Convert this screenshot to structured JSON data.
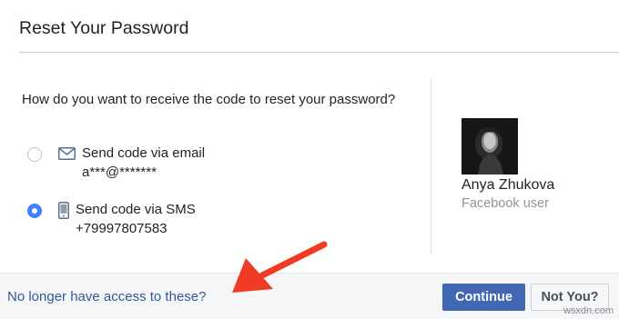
{
  "dialog": {
    "title": "Reset Your Password"
  },
  "main": {
    "question": "How do you want to receive the code to reset your password?",
    "options": [
      {
        "icon": "envelope-icon",
        "label": "Send code via email",
        "value": "a***@*******",
        "selected": false
      },
      {
        "icon": "mobile-phone-icon",
        "label": "Send code via SMS",
        "value": "+79997807583",
        "selected": true
      }
    ]
  },
  "profile": {
    "name": "Anya Zhukova",
    "subtitle": "Facebook user"
  },
  "footer": {
    "link_label": "No longer have access to these?",
    "continue_label": "Continue",
    "not_you_label": "Not You?"
  },
  "annotation": {
    "arrow_color": "#f03c26"
  },
  "watermark": "wsxdn.com",
  "colors": {
    "primary": "#4267b2",
    "link": "#365899",
    "radio_selected": "#4080ff",
    "text": "#1d2129",
    "muted": "#90949c"
  }
}
